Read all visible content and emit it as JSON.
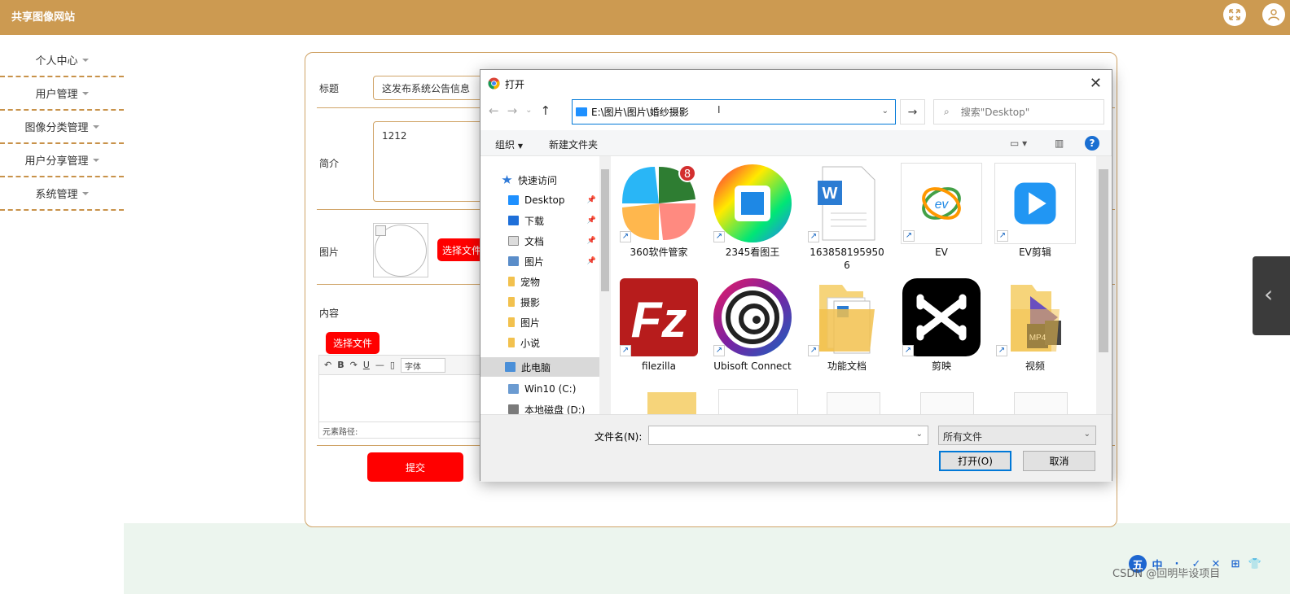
{
  "header": {
    "title": "共享图像网站"
  },
  "sidebar": {
    "items": [
      {
        "label": "个人中心"
      },
      {
        "label": "用户管理"
      },
      {
        "label": "图像分类管理"
      },
      {
        "label": "用户分享管理"
      },
      {
        "label": "系统管理"
      }
    ]
  },
  "form": {
    "title_label": "标题",
    "title_value": "这发布系统公告信息",
    "summary_label": "简介",
    "summary_value": "1212",
    "image_label": "图片",
    "choose_file_label": "选择文件",
    "content_label": "内容",
    "content_choose_file_label": "选择文件",
    "editor_font_label": "字体",
    "editor_path_label": "元素路径:",
    "submit_label": "提交"
  },
  "dialog": {
    "title": "打开",
    "address": "E:\\图片\\图片\\婚纱摄影",
    "search_placeholder": "搜索\"Desktop\"",
    "organize_label": "组织",
    "new_folder_label": "新建文件夹",
    "help_label": "?",
    "nav": [
      {
        "label": "快速访问",
        "color": "#2f7ad8",
        "pinned": false
      },
      {
        "label": "Desktop",
        "color": "#1e90ff",
        "pinned": true
      },
      {
        "label": "下载",
        "color": "#1e6fd9",
        "pinned": true
      },
      {
        "label": "文档",
        "color": "#8a8a8a",
        "pinned": true
      },
      {
        "label": "图片",
        "color": "#5a8dc9",
        "pinned": true
      },
      {
        "label": "宠物",
        "color": "#f2c14e",
        "pinned": false
      },
      {
        "label": "摄影",
        "color": "#f2c14e",
        "pinned": false
      },
      {
        "label": "图片",
        "color": "#f2c14e",
        "pinned": false
      },
      {
        "label": "小说",
        "color": "#f2c14e",
        "pinned": false
      },
      {
        "label": "此电脑",
        "color": "#4a8fd8",
        "pinned": false
      },
      {
        "label": "Win10 (C:)",
        "color": "#6b9bd1",
        "pinned": false
      },
      {
        "label": "本地磁盘 (D:)",
        "color": "#7a7a7a",
        "pinned": false
      }
    ],
    "files": [
      {
        "name": "360软件管家",
        "icon": "360-icon",
        "badge": "8"
      },
      {
        "name": "2345看图王",
        "icon": "2345-icon"
      },
      {
        "name": "1638581959506",
        "icon": "word-doc-icon"
      },
      {
        "name": "EV",
        "icon": "ev-icon"
      },
      {
        "name": "EV剪辑",
        "icon": "ev-edit-icon"
      },
      {
        "name": "filezilla",
        "icon": "filezilla-icon"
      },
      {
        "name": "Ubisoft Connect",
        "icon": "ubisoft-icon"
      },
      {
        "name": "功能文档",
        "icon": "folder-icon"
      },
      {
        "name": "剪映",
        "icon": "capcut-icon"
      },
      {
        "name": "视频",
        "icon": "video-folder-icon"
      }
    ],
    "filename_label": "文件名(N):",
    "filetype_value": "所有文件",
    "open_label": "打开(O)",
    "cancel_label": "取消"
  },
  "ime": {
    "first": "五",
    "items": [
      "中",
      "·",
      "✓",
      "✕",
      "⊞",
      "👕"
    ]
  },
  "watermark": "CSDN @回明毕设项目",
  "colors": {
    "header": "#cc9a51",
    "accent_red": "#ff0000",
    "dialog_blue": "#0078d7"
  }
}
